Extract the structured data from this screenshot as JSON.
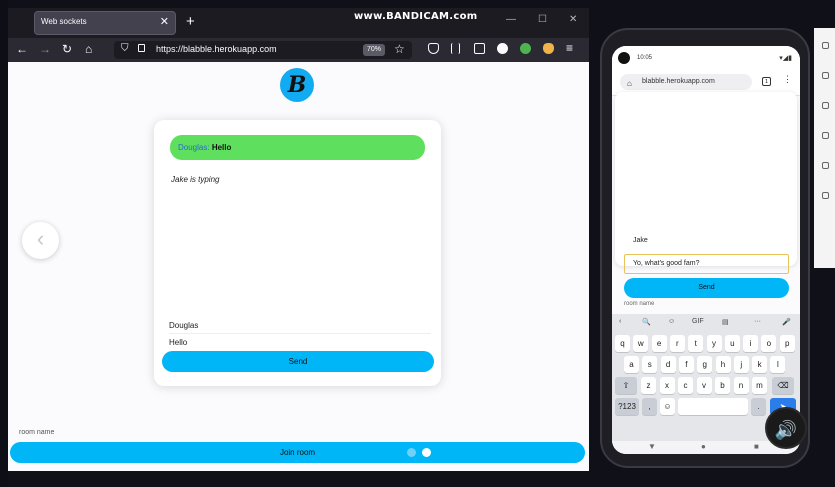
{
  "browser": {
    "tab_title": "Web sockets",
    "tab_close": "✕",
    "new_tab": "+",
    "watermark": "www.BANDICAM.com",
    "window_controls": [
      "—",
      "☐",
      "✕"
    ],
    "nav": {
      "back": "←",
      "forward": "→",
      "reload": "↻",
      "home": "⌂"
    },
    "url": "https://blabble.herokuapp.com",
    "zoom": "70%",
    "bookmark_star": "☆",
    "icons": [
      "pocket-icon",
      "library-icon",
      "reader-icon",
      "account-icon",
      "extension-icon",
      "profile-icon",
      "hamburger-menu-icon"
    ]
  },
  "app": {
    "logo_text": "B",
    "chat": {
      "message": {
        "user": "Douglas:",
        "text": "Hello"
      },
      "typing_status": "Jake is typing",
      "name_value": "Douglas",
      "message_value": "Hello",
      "send_label": "Send"
    },
    "prev_arrow": "‹",
    "room_label": "room name",
    "join_label": "Join room",
    "carousel": {
      "dots": 2,
      "active_index": 1,
      "inactive_color": "#6fd0f8",
      "active_color": "#ffffff"
    }
  },
  "phone": {
    "time": "10:05",
    "status_icons": "▾◢▮",
    "url": "blabble.herokuapp.com",
    "tab_count": "1",
    "menu": "⋮",
    "name_label": "Jake",
    "input_value": "Yo, what's good fam?",
    "send_label": "Send",
    "room_label": "room name",
    "keyboard": {
      "toolbar": [
        "‹",
        "🔍",
        "☺",
        "GIF",
        "▤",
        "···",
        "🎤"
      ],
      "row1": [
        "q",
        "w",
        "e",
        "r",
        "t",
        "y",
        "u",
        "i",
        "o",
        "p"
      ],
      "row1_hints": [
        "1",
        "2",
        "3",
        "4",
        "5",
        "6",
        "7",
        "8",
        "9",
        "0"
      ],
      "row2": [
        "a",
        "s",
        "d",
        "f",
        "g",
        "h",
        "j",
        "k",
        "l"
      ],
      "row3": [
        "⇧",
        "z",
        "x",
        "c",
        "v",
        "b",
        "n",
        "m",
        "⌫"
      ],
      "row4": [
        "?123",
        ",",
        "☺",
        "",
        ".",
        "➤"
      ]
    },
    "nav_buttons": [
      "▼",
      "●",
      "■"
    ]
  },
  "overlay": {
    "sound_icon": "🔊"
  },
  "colors": {
    "accent": "#00b6f7",
    "message_bubble": "#5ee05e",
    "username": "#2b67d6",
    "input_border": "#e8c25a"
  }
}
